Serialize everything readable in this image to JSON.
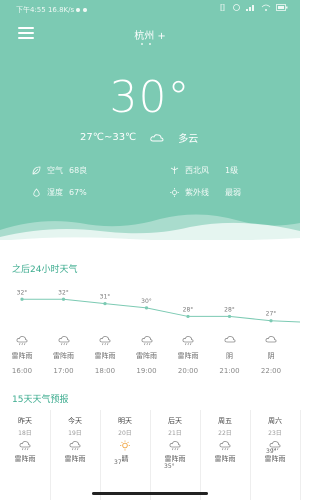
{
  "status_bar": {
    "time": "下午4:55",
    "speed": "16.8K/s"
  },
  "header": {
    "city": "杭州",
    "add_symbol": "+"
  },
  "current": {
    "temp": "30°",
    "range": "27℃~33℃",
    "condition": "多云",
    "air_label": "空气",
    "air_value": "68良",
    "humidity_label": "湿度",
    "humidity_value": "67%",
    "wind_dir": "西北风",
    "wind_level": "1级",
    "uv_label": "紫外线",
    "uv_value": "最弱"
  },
  "hourly": {
    "title": "之后24小时天气",
    "temps": [
      "32°",
      "32°",
      "31°",
      "30°",
      "28°",
      "28°",
      "27°"
    ],
    "temp_values": [
      32,
      32,
      31,
      30,
      28,
      28,
      27
    ],
    "conditions": [
      "雷阵雨",
      "雷阵雨",
      "雷阵雨",
      "雷阵雨",
      "雷阵雨",
      "阴",
      "阴"
    ],
    "times": [
      "16:00",
      "17:00",
      "18:00",
      "19:00",
      "20:00",
      "21:00",
      "22:00"
    ],
    "icons": [
      "rain-icon",
      "rain-icon",
      "rain-icon",
      "rain-icon",
      "rain-icon",
      "cloud-icon",
      "cloud-icon"
    ]
  },
  "daily": {
    "title": "15天天气预报",
    "days": [
      {
        "name": "昨天",
        "date": "18日",
        "condition": "雷阵雨",
        "icon": "rain-icon"
      },
      {
        "name": "今天",
        "date": "19日",
        "condition": "雷阵雨",
        "icon": "rain-icon"
      },
      {
        "name": "明天",
        "date": "20日",
        "condition": "晴",
        "icon": "sun-icon"
      },
      {
        "name": "后天",
        "date": "21日",
        "condition": "雷阵雨",
        "icon": "rain-icon"
      },
      {
        "name": "周五",
        "date": "22日",
        "condition": "雷阵雨",
        "icon": "rain-icon"
      },
      {
        "name": "周六",
        "date": "23日",
        "condition": "雷阵雨",
        "icon": "rain-icon"
      }
    ],
    "visible_highs": [
      "37°",
      "35°",
      "39°"
    ]
  },
  "colors": {
    "hero": "#7ccab3",
    "accent": "#3bab8e"
  }
}
